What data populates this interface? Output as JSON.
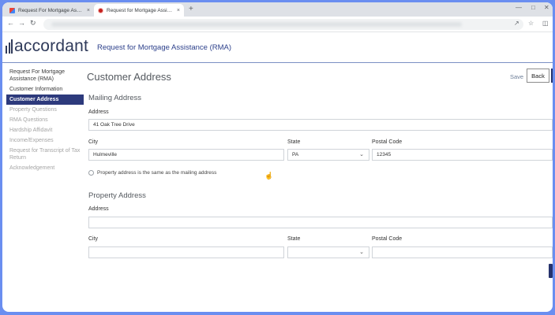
{
  "browser": {
    "tabs": [
      {
        "title": "Request For Mortgage Assistanc",
        "icon": "gmail-icon"
      },
      {
        "title": "Request for Mortgage Assistanc",
        "icon": "accordant-favicon"
      }
    ],
    "close_glyph": "×",
    "new_tab_glyph": "+"
  },
  "app": {
    "logo_text": "accordant",
    "title": "Request for Mortgage Assistance (RMA)"
  },
  "sidebar": {
    "items": [
      {
        "label": "Request For Mortgage Assistance (RMA)",
        "state": "normal"
      },
      {
        "label": "Customer Information",
        "state": "normal"
      },
      {
        "label": "Customer Address",
        "state": "active"
      },
      {
        "label": "Property Questions",
        "state": "disabled"
      },
      {
        "label": "RMA Questions",
        "state": "disabled"
      },
      {
        "label": "Hardship Affidavit",
        "state": "disabled"
      },
      {
        "label": "Income/Expenses",
        "state": "disabled"
      },
      {
        "label": "Request for Transcript of Tax Return",
        "state": "disabled"
      },
      {
        "label": "Acknowledgement",
        "state": "disabled"
      }
    ]
  },
  "main": {
    "heading": "Customer Address",
    "save_label": "Save",
    "back_label": "Back",
    "mailing": {
      "title": "Mailing Address",
      "address_label": "Address",
      "address_value": "41 Oak Tree Drive",
      "city_label": "City",
      "city_value": "Hulmeville",
      "state_label": "State",
      "state_value": "PA",
      "postal_label": "Postal Code",
      "postal_value": "12345"
    },
    "same_as_mailing_label": "Property address is the same as the mailing address",
    "property": {
      "title": "Property Address",
      "address_label": "Address",
      "address_value": "",
      "city_label": "City",
      "city_value": "",
      "state_label": "State",
      "state_value": "",
      "postal_label": "Postal Code",
      "postal_value": ""
    }
  },
  "colors": {
    "active_nav": "#2d3a7c",
    "header_title": "#2b3f8a",
    "outer_frame": "#6a8ef0"
  }
}
